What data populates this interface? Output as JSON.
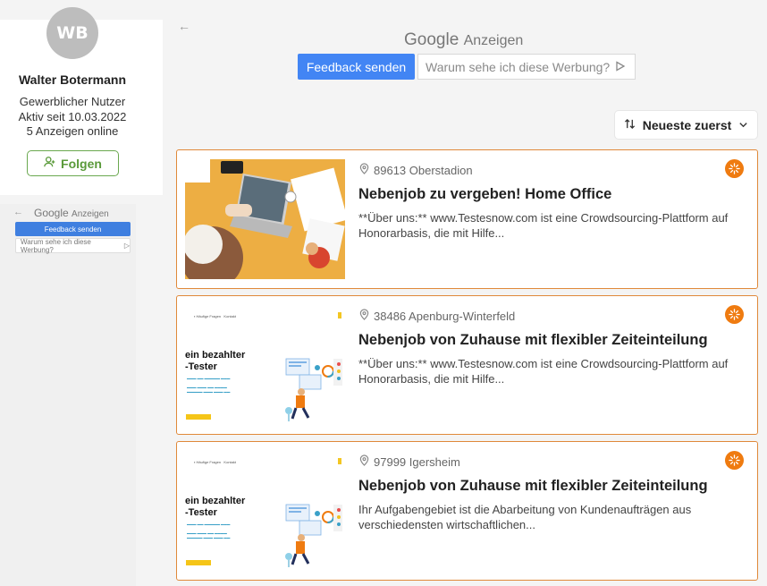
{
  "profile": {
    "initials": "WB",
    "name": "Walter Botermann",
    "type": "Gewerblicher Nutzer",
    "active_since": "Aktiv seit 10.03.2022",
    "ads_online": "5 Anzeigen online",
    "follow_label": "Folgen"
  },
  "mini_ad": {
    "google": "Google",
    "anzeigen": "Anzeigen",
    "feedback": "Feedback senden",
    "why": "Warum sehe ich diese Werbung?"
  },
  "ads_header": {
    "google": "Google",
    "anzeigen": "Anzeigen",
    "feedback": "Feedback senden",
    "why": "Warum sehe ich diese Werbung?"
  },
  "sort": {
    "label": "Neueste zuerst"
  },
  "listings": [
    {
      "location": "89613 Oberstadion",
      "title": "Nebenjob zu vergeben! Home Office",
      "description": "**Über uns:** www.Testesnow.com ist eine Crowdsourcing-Plattform auf Honorarbasis, die mit Hilfe..."
    },
    {
      "location": "38486 Apenburg-Winterfeld",
      "title": "Nebenjob von Zuhause mit flexibler Zeiteinteilung",
      "description": "**Über uns:** www.Testesnow.com ist eine Crowdsourcing-Plattform auf Honorarbasis, die mit Hilfe...",
      "thumb_heading_1": "ein bezahlter",
      "thumb_heading_2": "-Tester"
    },
    {
      "location": "97999 Igersheim",
      "title": "Nebenjob von Zuhause mit flexibler Zeiteinteilung",
      "description": "Ihr Aufgabengebiet ist die Abarbeitung von Kundenaufträgen aus verschiedensten wirtschaftlichen...",
      "thumb_heading_1": "ein bezahlter",
      "thumb_heading_2": "-Tester"
    }
  ],
  "colors": {
    "accent_orange": "#e0893a",
    "badge_orange": "#ef7b10",
    "google_blue": "#4285f4",
    "follow_green": "#6aa84f"
  }
}
